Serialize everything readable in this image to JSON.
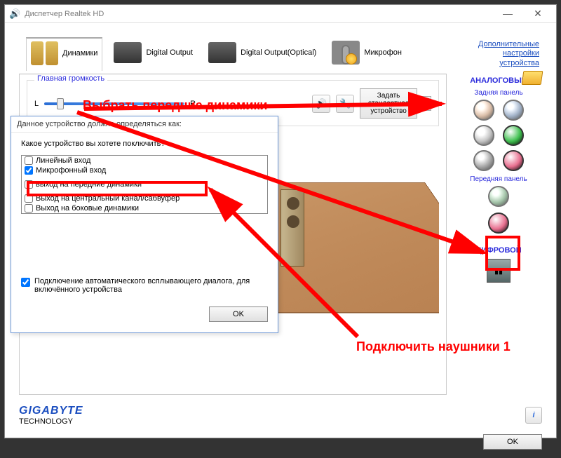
{
  "window": {
    "title": "Диспетчер Realtek HD",
    "minimize": "—",
    "close": "✕"
  },
  "tabs": {
    "speakers": "Динамики",
    "digital": "Digital Output",
    "digital_optical": "Digital Output(Optical)",
    "mic": "Микрофон"
  },
  "adv_link": {
    "l1": "Дополнительные",
    "l2": "настройки",
    "l3": "устройства"
  },
  "volume": {
    "legend": "Главная громкость",
    "left": "L",
    "right": "R",
    "default_btn": "Задать стандартное устройство",
    "dd": "▼"
  },
  "side": {
    "analog": "АНАЛОГОВЫЙ",
    "rear": "Задняя панель",
    "front": "Передняя панель",
    "digital": "ЦИФРОВОЙ",
    "jacks": {
      "r1c1": "#d48040",
      "r1c2": "#5080c0",
      "r2c1": "#909090",
      "r2c2": "#40c050",
      "r3c1": "#707070",
      "r3c2": "#e87090",
      "f1": "#40a050",
      "f2": "#e87090"
    }
  },
  "dialog": {
    "title": "Данное устройство должно определяться как:",
    "prompt": "Какое устройство вы хотете поключить?",
    "opts": {
      "line_in": "Линейный вход",
      "mic_in": "Микрофонный вход",
      "front_out": "выход на передние динамики",
      "center_out": "Выход на центральный канал/сабвуфер",
      "side_out": "Выход на боковые динамики"
    },
    "auto_popup": "Подключение автоматического всплывающего диалога, для включённого устройства",
    "ok": "OK"
  },
  "footer": {
    "brand": "GIGABYTE",
    "tag": "TECHNOLOGY",
    "info": "i",
    "ok": "OK"
  },
  "annot": {
    "a1": "Выбрать передние динамики",
    "a2": "Подключить наушники 1"
  }
}
